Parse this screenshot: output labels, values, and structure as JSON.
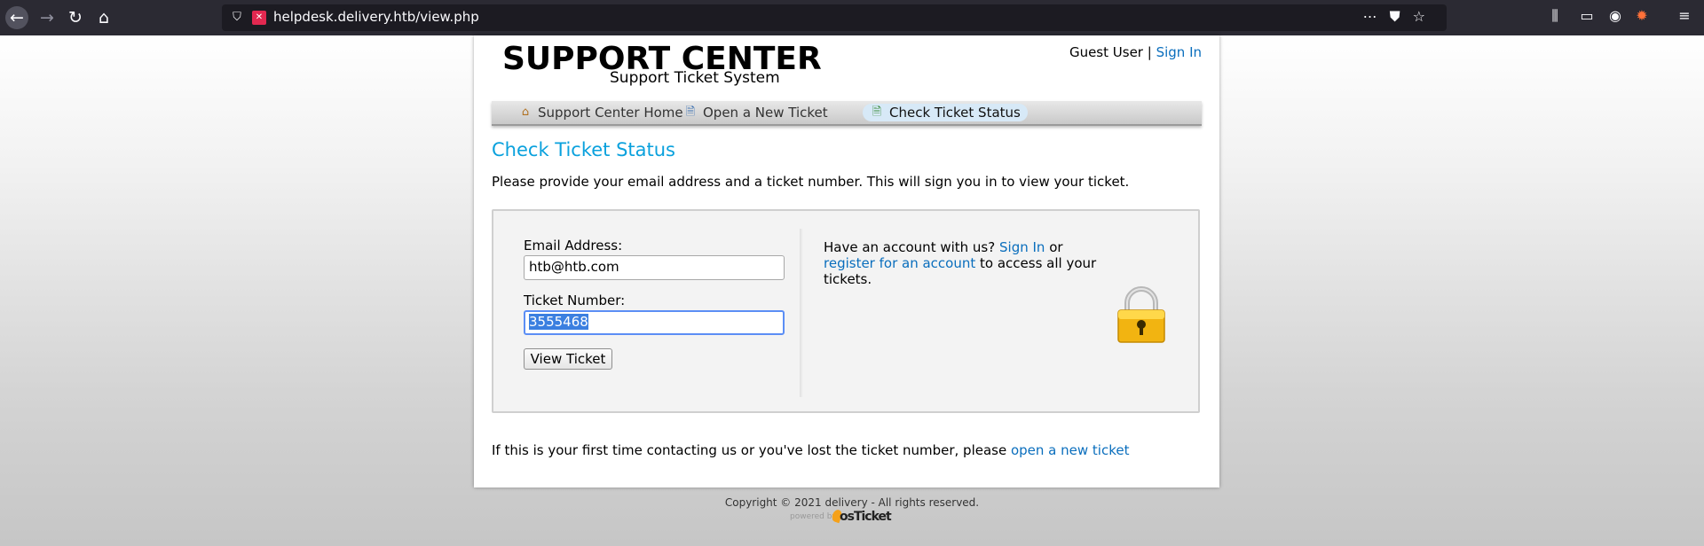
{
  "browser": {
    "url": "helpdesk.delivery.htb/view.php"
  },
  "header": {
    "logo_title": "SUPPORT CENTER",
    "logo_subtitle": "Support Ticket System",
    "guest_user": "Guest User |",
    "sign_in": "Sign In"
  },
  "nav": {
    "items": [
      {
        "label": "Support Center Home",
        "icon": "home-icon"
      },
      {
        "label": "Open a New Ticket",
        "icon": "new-ticket-icon"
      },
      {
        "label": "Check Ticket Status",
        "icon": "ticket-status-icon",
        "active": true
      }
    ]
  },
  "main": {
    "title": "Check Ticket Status",
    "intro": "Please provide your email address and a ticket number. This will sign you in to view your ticket.",
    "email_label": "Email Address:",
    "email_value": "htb@htb.com",
    "ticket_label": "Ticket Number:",
    "ticket_value": "3555468",
    "view_button": "View Ticket",
    "account_prefix": "Have an account with us?",
    "account_sign_in": "Sign In",
    "account_or": "or",
    "account_register": "register for an account",
    "account_suffix": "to access all your tickets.",
    "footer_prefix": "If this is your first time contacting us or you've lost the ticket number, please",
    "footer_link": "open a new ticket"
  },
  "page_footer": {
    "copyright": "Copyright © 2021 delivery - All rights reserved.",
    "powered_by": "powered by",
    "brand": "osTicket"
  },
  "colors": {
    "link": "#0a6ebd",
    "title": "#0aa1dd",
    "selection": "#3b7fe0"
  }
}
